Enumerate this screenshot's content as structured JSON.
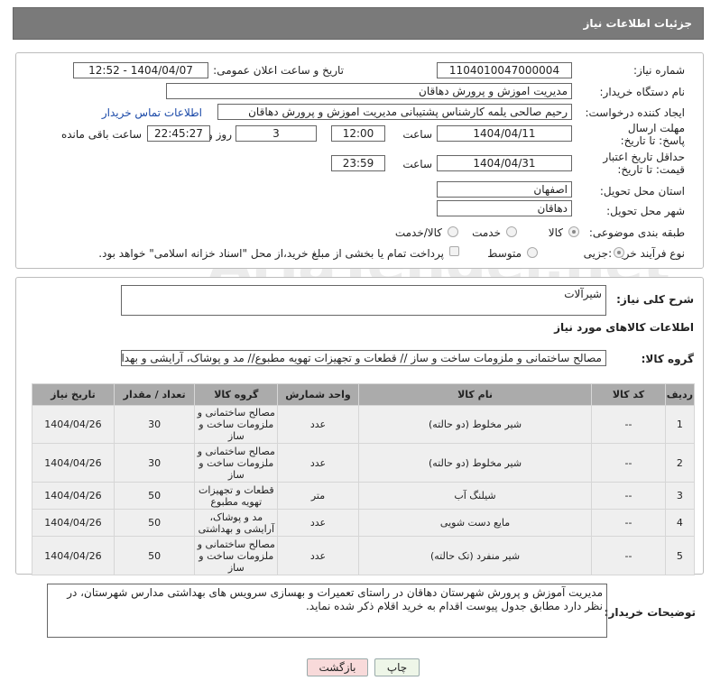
{
  "header": {
    "title": "جزئیات اطلاعات نیاز"
  },
  "form": {
    "need_number_label": "شماره نیاز:",
    "need_number": "1104010047000004",
    "announce_label": "تاریخ و ساعت اعلان عمومی:",
    "announce_value": "1404/04/07 - 12:52",
    "buyer_label": "نام دستگاه خریدار:",
    "buyer_value": "مدیریت اموزش و پرورش دهاقان",
    "creator_label": "ایجاد کننده درخواست:",
    "creator_value": "رحیم صالحی یلمه کارشناس پشتیبانی مدیریت اموزش و پرورش دهاقان",
    "contact_link": "اطلاعات تماس خریدار",
    "deadline_label": "مهلت ارسال پاسخ: تا تاریخ:",
    "deadline_date": "1404/04/11",
    "time_label": "ساعت",
    "deadline_time": "12:00",
    "days_value": "3",
    "days_label": "روز و",
    "remaining_time": "22:45:27",
    "remaining_label": "ساعت باقی مانده",
    "min_price_label": "حداقل تاریخ اعتبار قیمت: تا تاریخ:",
    "min_price_date": "1404/04/31",
    "min_price_time": "23:59",
    "province_label": "استان محل تحویل:",
    "province_value": "اصفهان",
    "city_label": "شهر محل تحویل:",
    "city_value": "دهاقان",
    "category_label": "طبقه بندی موضوعی:",
    "cat_goods": "کالا",
    "cat_service": "خدمت",
    "cat_goods_service": "کالا/خدمت",
    "process_label": "نوع فرآیند خرید :",
    "proc_partial": "جزیی",
    "proc_medium": "متوسط",
    "payment_note": "پرداخت تمام یا بخشی از مبلغ خرید،از محل \"اسناد خزانه اسلامی\" خواهد بود."
  },
  "summary": {
    "desc_label": "شرح کلی نیاز:",
    "desc_value": "شیرآلات",
    "goods_info_title": "اطلاعات کالاهای مورد نیاز",
    "goods_group_label": "گروه کالا:",
    "goods_group_value": "مصالح ساختمانی و ملزومات ساخت و ساز // قطعات و تجهیزات تهویه مطبوع// مد و پوشاک، آرایشی و بهداش"
  },
  "table": {
    "headers": [
      "ردیف",
      "کد کالا",
      "نام کالا",
      "واحد شمارش",
      "گروه کالا",
      "تعداد / مقدار",
      "تاریخ نیاز"
    ],
    "rows": [
      {
        "row": "1",
        "code": "--",
        "name": "شیر مخلوط (دو حالته)",
        "unit": "عدد",
        "group": "مصالح ساختمانی و ملزومات ساخت و ساز",
        "qty": "30",
        "date": "1404/04/26"
      },
      {
        "row": "2",
        "code": "--",
        "name": "شیر مخلوط (دو حالته)",
        "unit": "عدد",
        "group": "مصالح ساختمانی و ملزومات ساخت و ساز",
        "qty": "30",
        "date": "1404/04/26"
      },
      {
        "row": "3",
        "code": "--",
        "name": "شیلنگ آب",
        "unit": "متر",
        "group": "قطعات و تجهیزات تهویه مطبوع",
        "qty": "50",
        "date": "1404/04/26"
      },
      {
        "row": "4",
        "code": "--",
        "name": "مایع دست شویی",
        "unit": "عدد",
        "group": "مد و پوشاک، آرایشی و بهداشتی",
        "qty": "50",
        "date": "1404/04/26"
      },
      {
        "row": "5",
        "code": "--",
        "name": "شیر منفرد (تک حالته)",
        "unit": "عدد",
        "group": "مصالح ساختمانی و ملزومات ساخت و ساز",
        "qty": "50",
        "date": "1404/04/26"
      }
    ]
  },
  "notes": {
    "label": "توضیحات خریدار:",
    "value": "مدیریت آموزش و پرورش شهرستان دهاقان در راستای تعمیرات و بهسازی سرویس های بهداشتی مدارس شهرستان، در نظر دارد مطابق جدول پیوست اقدام به خرید اقلام ذکر شده نماید."
  },
  "buttons": {
    "print": "چاپ",
    "back": "بازگشت"
  }
}
